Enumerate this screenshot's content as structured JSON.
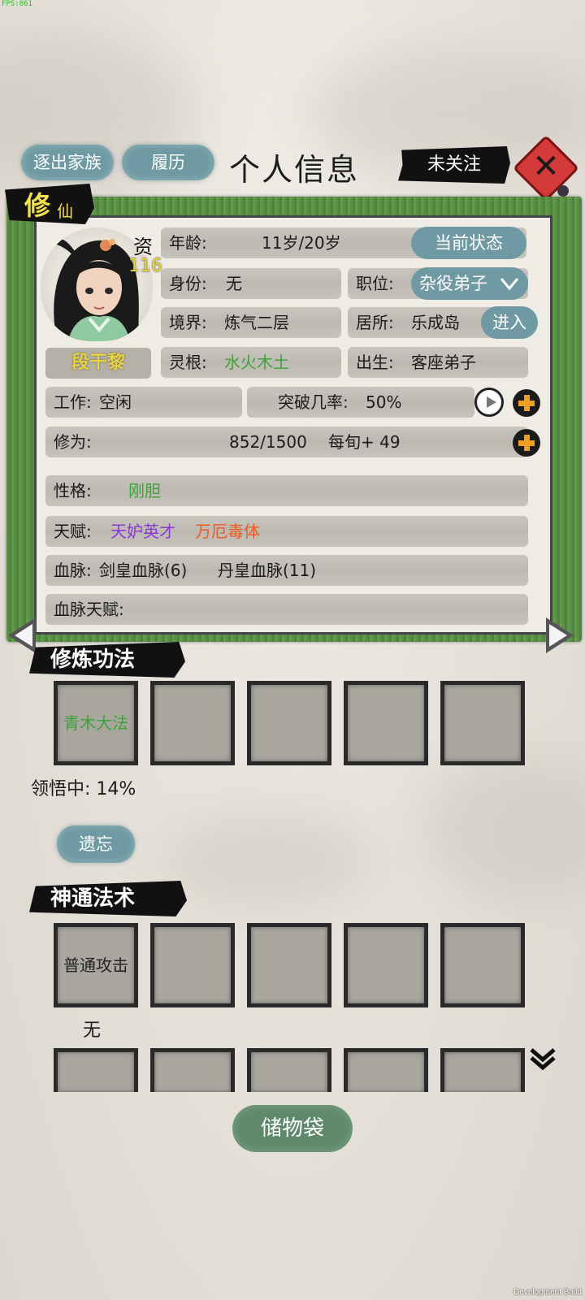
{
  "debug": {
    "fps": "FPS:061",
    "build": "Development Build"
  },
  "header": {
    "expel_label": "逐出家族",
    "history_label": "履历",
    "title": "个人信息",
    "follow_label": "未关注"
  },
  "cultivation_tag": {
    "big": "修",
    "small": "仙"
  },
  "character": {
    "name": "段干黎",
    "aptitude_label": "资",
    "aptitude_value": "116",
    "age_label": "年龄:",
    "age_value": "11岁/20岁",
    "status_button": "当前状态",
    "identity_label": "身份:",
    "identity_value": "无",
    "position_label": "职位:",
    "position_value": "杂役弟子",
    "realm_label": "境界:",
    "realm_value": "炼气二层",
    "residence_label": "居所:",
    "residence_value": "乐成岛",
    "enter_button": "进入",
    "root_label": "灵根:",
    "root_value": "水火木土",
    "origin_label": "出生:",
    "origin_value": "客座弟子",
    "work_label": "工作:",
    "work_value": "空闲",
    "breakthrough_label": "突破几率:",
    "breakthrough_value": "50%",
    "cultivation_label": "修为:",
    "cultivation_value": "852/1500",
    "cultivation_rate": "每旬+ 49",
    "personality_label": "性格:",
    "personality_value": "刚胆",
    "talent_label": "天赋:",
    "talent_1": "天妒英才",
    "talent_2": "万厄毒体",
    "bloodline_label": "血脉:",
    "bloodline_1": "剑皇血脉(6)",
    "bloodline_2": "丹皇血脉(11)",
    "bloodline_talent_label": "血脉天赋:"
  },
  "techniques": {
    "title": "修炼功法",
    "slot_1": "青木大法",
    "progress_label": "领悟中:",
    "progress_value": "14%",
    "forget_button": "遗忘"
  },
  "skills": {
    "title": "神通法术",
    "slot_1": "普通攻击",
    "slot_1_sub": "无"
  },
  "storage_button": "储物袋",
  "colors": {
    "teal_button": "#6f9aa3",
    "board_green": "#5b8f46",
    "spirit_root": "#3fa23a",
    "talent_purple": "#8c35d8",
    "talent_orange": "#ef5a1d",
    "name_gold": "#e8d340"
  }
}
